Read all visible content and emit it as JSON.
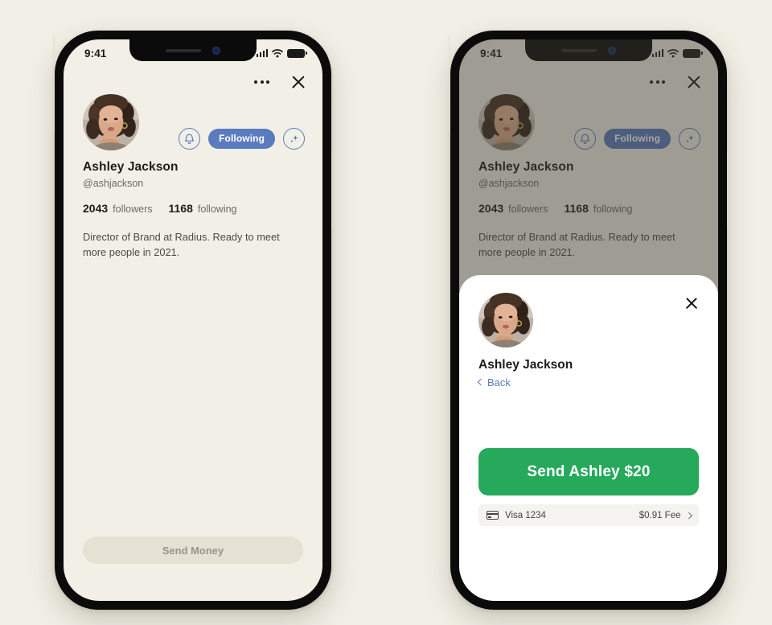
{
  "page": {
    "background_color": "#F2F0E6",
    "accent_blue": "#5A7BBE",
    "accent_green": "#27A95C"
  },
  "status_bar": {
    "time": "9:41",
    "signal_icon": "cellular-signal-icon",
    "wifi_icon": "wifi-icon",
    "battery_icon": "battery-icon"
  },
  "profile_screen": {
    "more_icon": "more-options-icon",
    "close_icon": "close-icon",
    "avatar_icon": "user-avatar-photo",
    "notify_icon": "bell-icon",
    "following_label": "Following",
    "sparkle_icon": "sparkle-add-icon",
    "display_name": "Ashley Jackson",
    "handle": "@ashjackson",
    "followers_count": "2043",
    "followers_label": "followers",
    "following_count": "1168",
    "following_label_text": "following",
    "bio": "Director of Brand at Radius. Ready to meet more people in 2021.",
    "send_money_label": "Send Money"
  },
  "payment_sheet": {
    "close_icon": "close-icon",
    "avatar_icon": "user-avatar-photo",
    "name": "Ashley Jackson",
    "back_label": "Back",
    "back_icon": "chevron-left-icon",
    "cta_label": "Send Ashley $20",
    "card_icon": "credit-card-icon",
    "card_label": "Visa 1234",
    "fee_label": "$0.91 Fee",
    "chevron_icon": "chevron-right-icon"
  }
}
